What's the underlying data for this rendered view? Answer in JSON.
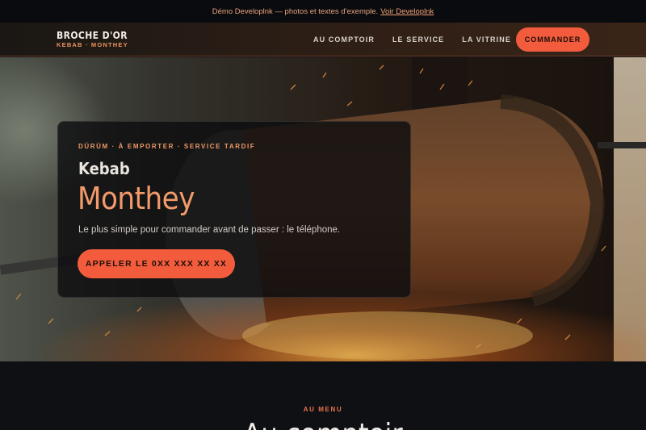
{
  "banner": {
    "text": "Démo Developlnk — photos et textes d’exemple.",
    "link_label": "Voir Developlnk"
  },
  "brand": {
    "name": "BROCHE D'OR",
    "tagline": "KEBAB · MONTHEY"
  },
  "nav": {
    "items": [
      {
        "label": "AU COMPTOIR"
      },
      {
        "label": "LE SERVICE"
      },
      {
        "label": "LA VITRINE"
      }
    ],
    "cta_label": "COMMANDER"
  },
  "hero": {
    "eyebrow": "DÜRÜM · À EMPORTER · SERVICE TARDIF",
    "title_line1": "Kebab",
    "title_line2": "Monthey",
    "description": "Le plus simple pour commander avant de passer : le téléphone.",
    "call_button_label": "APPELER LE 0XX XXX XX XX"
  },
  "menu_section": {
    "eyebrow": "AU MENU",
    "heading": "Au comptoir"
  },
  "colors": {
    "accent": "#f25c3d",
    "accent_text": "#ee9a66",
    "title_accent": "#f29a6a",
    "background": "#0e1014"
  }
}
